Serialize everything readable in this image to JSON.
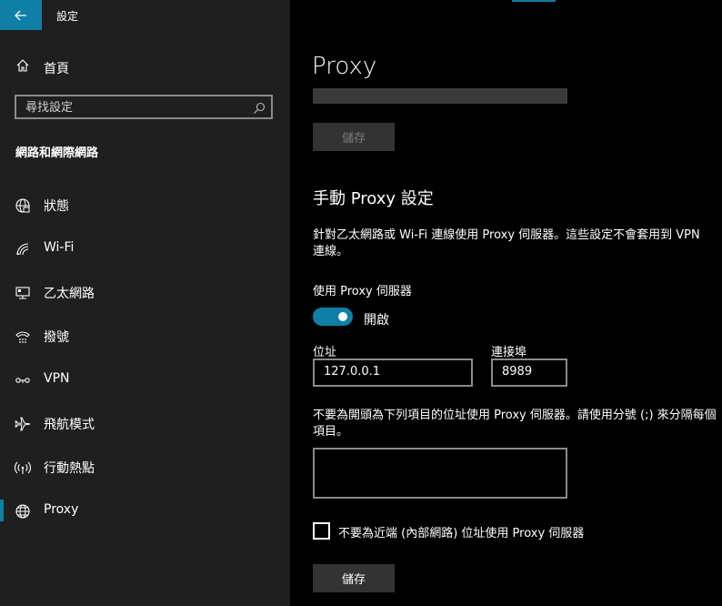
{
  "app": {
    "title": "設定"
  },
  "sidebar": {
    "home_label": "首頁",
    "search_placeholder": "尋找設定",
    "section_title": "網路和網際網路",
    "items": [
      {
        "label": "狀態",
        "icon": "globe-status-icon"
      },
      {
        "label": "Wi-Fi",
        "icon": "wifi-icon"
      },
      {
        "label": "乙太網路",
        "icon": "ethernet-icon"
      },
      {
        "label": "撥號",
        "icon": "dialup-icon"
      },
      {
        "label": "VPN",
        "icon": "vpn-icon"
      },
      {
        "label": "飛航模式",
        "icon": "airplane-icon"
      },
      {
        "label": "行動熱點",
        "icon": "hotspot-icon"
      },
      {
        "label": "Proxy",
        "icon": "globe-icon",
        "active": true
      }
    ]
  },
  "main": {
    "title": "Proxy",
    "save_label_top": "儲存",
    "manual_heading": "手動 Proxy 設定",
    "manual_desc": "針對乙太網路或 Wi-Fi 連線使用 Proxy 伺服器。這些設定不會套用到 VPN 連線。",
    "use_proxy_label": "使用 Proxy 伺服器",
    "toggle_state": "開啟",
    "address_label": "位址",
    "address_value": "127.0.0.1",
    "port_label": "連接埠",
    "port_value": "8989",
    "exceptions_desc": "不要為開頭為下列項目的位址使用 Proxy 伺服器。請使用分號 (;) 來分隔每個項目。",
    "exceptions_value": "",
    "local_checkbox_label": "不要為近端 (內部網路) 位址使用 Proxy 伺服器",
    "local_checkbox_checked": false,
    "save_label": "儲存"
  },
  "colors": {
    "accent": "#0f7fa6",
    "sidebar_bg": "#1f1f1f",
    "main_bg": "#000000"
  }
}
